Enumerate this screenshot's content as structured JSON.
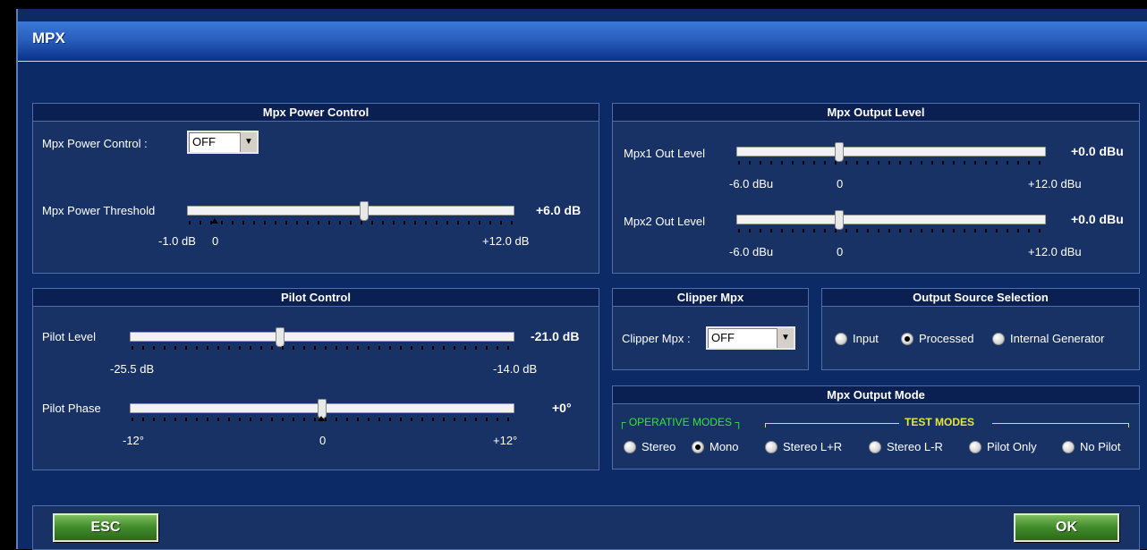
{
  "window": {
    "title": "MPX"
  },
  "power": {
    "header": "Mpx Power Control",
    "control_label": "Mpx Power Control :",
    "control_value": "OFF",
    "threshold_label": "Mpx Power Threshold",
    "threshold_value": "+6.0 dB",
    "threshold_level": 0.54,
    "min": "-1.0 dB",
    "zero": "0",
    "max": "+12.0 dB"
  },
  "output_level": {
    "header": "Mpx Output Level",
    "mpx1_label": "Mpx1 Out Level",
    "mpx1_value": "+0.0 dBu",
    "mpx1_level": 0.33,
    "mpx2_label": "Mpx2 Out Level",
    "mpx2_value": "+0.0 dBu",
    "mpx2_level": 0.33,
    "min": "-6.0 dBu",
    "zero": "0",
    "max": "+12.0 dBu"
  },
  "pilot": {
    "header": "Pilot Control",
    "level_label": "Pilot Level",
    "level_value": "-21.0 dB",
    "level_level": 0.39,
    "level_min": "-25.5 dB",
    "level_max": "-14.0 dB",
    "phase_label": "Pilot Phase",
    "phase_value": "+0°",
    "phase_level": 0.5,
    "phase_min": "-12°",
    "phase_zero": "0",
    "phase_max": "+12°"
  },
  "clipper": {
    "header": "Clipper Mpx",
    "label": "Clipper Mpx :",
    "value": "OFF"
  },
  "source": {
    "header": "Output Source Selection",
    "options": [
      "Input",
      "Processed",
      "Internal Generator"
    ],
    "selected": "Processed"
  },
  "mode": {
    "header": "Mpx Output Mode",
    "operative_label": "OPERATIVE MODES",
    "test_label": "TEST MODES",
    "options": [
      "Stereo",
      "Mono",
      "Stereo L+R",
      "Stereo L-R",
      "Pilot Only",
      "No Pilot"
    ],
    "selected": "Mono",
    "operative_color": "#33e633",
    "test_color": "#e6e633"
  },
  "buttons": {
    "esc": "ESC",
    "ok": "OK"
  }
}
